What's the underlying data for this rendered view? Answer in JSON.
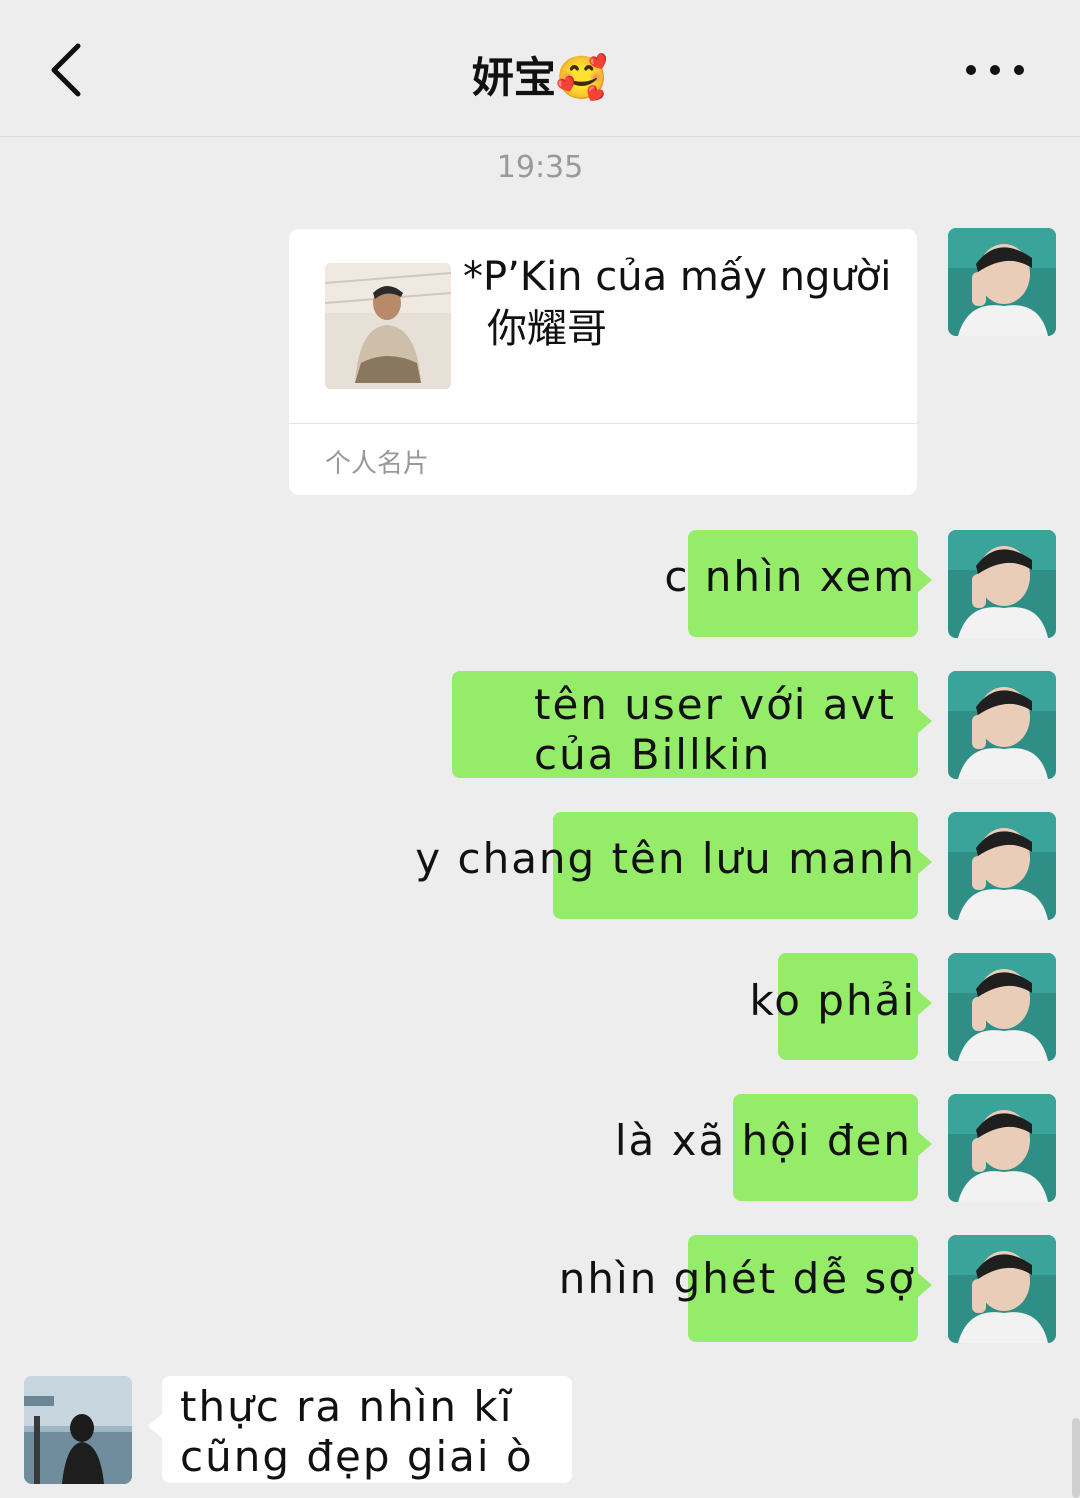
{
  "header": {
    "title": "妍宝",
    "title_emoji": "🥰",
    "back_icon": "chevron-left-icon",
    "more_icon": "ellipsis-icon"
  },
  "timestamp": "19:35",
  "contact_card": {
    "name_line1": "*P’Kin của mấy người",
    "name_line2": "你耀哥",
    "footer": "个人名片"
  },
  "messages_me": [
    {
      "text": "c nhìn xem"
    },
    {
      "text_line1": "tên user với avt",
      "text_line2": "của Billkin"
    },
    {
      "text": "y chang tên lưu manh"
    },
    {
      "text": "ko phải"
    },
    {
      "text": "là xã hội đen"
    },
    {
      "text": "nhìn ghét dễ sợ"
    }
  ],
  "message_friend": {
    "text_line1": "thực ra nhìn kĩ",
    "text_line2": "cũng đẹp giai ò"
  },
  "colors": {
    "background": "#ededed",
    "my_bubble": "#95ec69",
    "friend_bubble": "#ffffff",
    "muted_text": "#999999"
  }
}
